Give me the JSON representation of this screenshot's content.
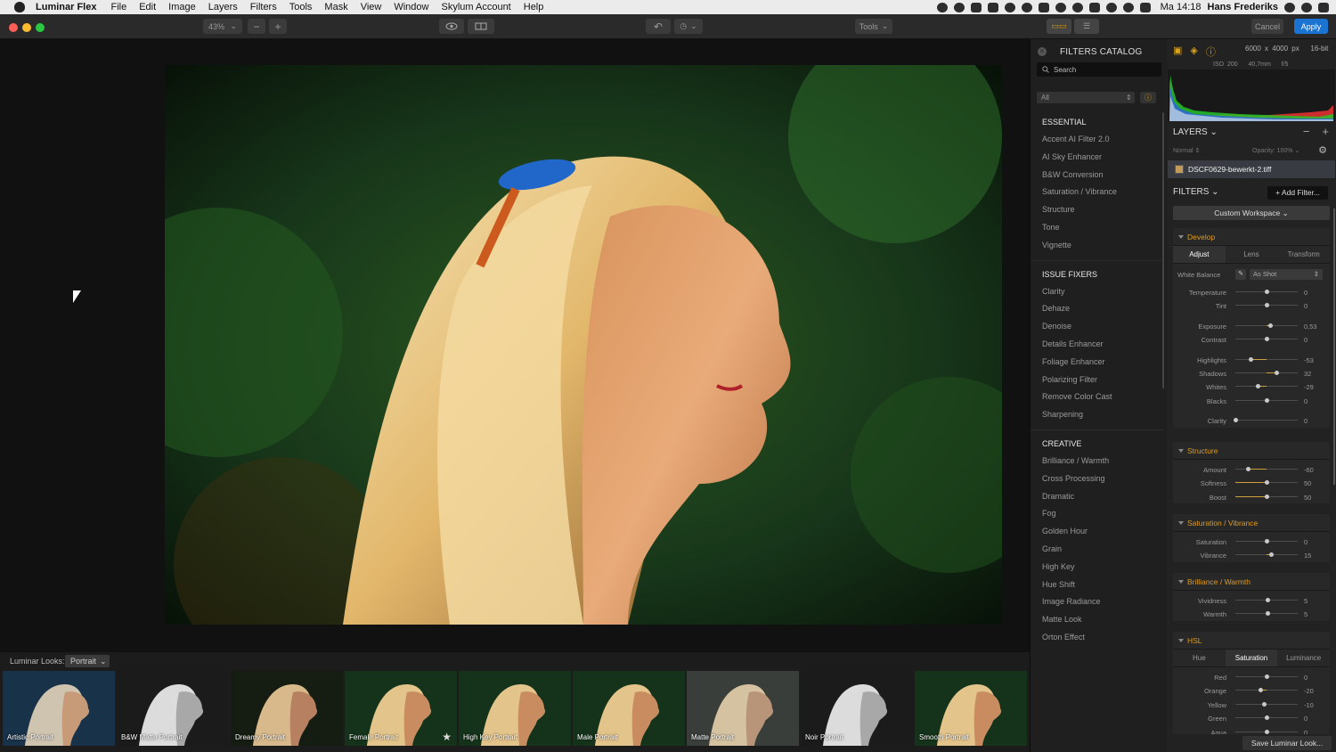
{
  "menubar": {
    "app": "Luminar Flex",
    "items": [
      "File",
      "Edit",
      "Image",
      "Layers",
      "Filters",
      "Tools",
      "Mask",
      "View",
      "Window",
      "Skylum Account",
      "Help"
    ],
    "clock": "Ma 14:18",
    "user": "Hans Frederiks"
  },
  "toolbar": {
    "zoom": "43%",
    "zoom_out": "−",
    "zoom_in": "+",
    "tools": "Tools",
    "cancel": "Cancel",
    "apply": "Apply"
  },
  "looks": {
    "label": "Luminar Looks:",
    "category": "Portrait",
    "items": [
      {
        "name": "Artistic Portrait",
        "tint": "cool"
      },
      {
        "name": "B&W Matte Portrait",
        "tint": "bw"
      },
      {
        "name": "Dreamy Portrait",
        "tint": "dark"
      },
      {
        "name": "Female Portrait",
        "tint": "green",
        "starred": true
      },
      {
        "name": "High Key Portrait",
        "tint": "green"
      },
      {
        "name": "Male Portrait",
        "tint": "green"
      },
      {
        "name": "Matte Portrait",
        "tint": "matte"
      },
      {
        "name": "Noir Portrait",
        "tint": "bw"
      },
      {
        "name": "Smooth Portrait",
        "tint": "green"
      }
    ]
  },
  "catalog": {
    "title": "FILTERS CATALOG",
    "search_placeholder": "Search",
    "filter": "All",
    "sections": [
      {
        "title": "ESSENTIAL",
        "items": [
          "Accent AI Filter 2.0",
          "AI Sky Enhancer",
          "B&W Conversion",
          "Saturation / Vibrance",
          "Structure",
          "Tone",
          "Vignette"
        ]
      },
      {
        "title": "ISSUE FIXERS",
        "items": [
          "Clarity",
          "Dehaze",
          "Denoise",
          "Details Enhancer",
          "Foliage Enhancer",
          "Polarizing Filter",
          "Remove Color Cast",
          "Sharpening"
        ]
      },
      {
        "title": "CREATIVE",
        "items": [
          "Brilliance / Warmth",
          "Cross Processing",
          "Dramatic",
          "Fog",
          "Golden Hour",
          "Grain",
          "High Key",
          "Hue Shift",
          "Image Radiance",
          "Matte Look",
          "Orton Effect"
        ]
      }
    ]
  },
  "info": {
    "dims": "6000 x 4000 px",
    "bits": "16-bit",
    "iso": "ISO 200",
    "focal": "40,7mm",
    "aperture": "f/5"
  },
  "layers": {
    "title": "LAYERS",
    "blend": "Normal",
    "opacity": "Opacity: 100%",
    "layer_name": "DSCF0629-bewerkt-2.tiff"
  },
  "filters": {
    "title": "FILTERS",
    "add": "+ Add Filter...",
    "workspace": "Custom Workspace",
    "develop": {
      "title": "Develop",
      "tabs": [
        "Adjust",
        "Lens",
        "Transform"
      ],
      "wb_label": "White Balance",
      "wb_value": "As Shot",
      "groups": [
        [
          {
            "label": "Temperature",
            "value": "0",
            "pos": 0.5,
            "centered": true
          },
          {
            "label": "Tint",
            "value": "0",
            "pos": 0.5,
            "centered": true
          }
        ],
        [
          {
            "label": "Exposure",
            "value": "0,53",
            "pos": 0.55,
            "centered": true
          },
          {
            "label": "Contrast",
            "value": "0",
            "pos": 0.5,
            "centered": true
          }
        ],
        [
          {
            "label": "Highlights",
            "value": "-53",
            "pos": 0.24,
            "centered": true
          },
          {
            "label": "Shadows",
            "value": "32",
            "pos": 0.66,
            "centered": true
          },
          {
            "label": "Whites",
            "value": "-29",
            "pos": 0.36,
            "centered": true
          },
          {
            "label": "Blacks",
            "value": "0",
            "pos": 0.5,
            "centered": true
          }
        ],
        [
          {
            "label": "Clarity",
            "value": "0",
            "pos": 0.0,
            "centered": false
          }
        ]
      ]
    },
    "structure": {
      "title": "Structure",
      "sliders": [
        {
          "label": "Amount",
          "value": "-60",
          "pos": 0.2,
          "centered": true
        },
        {
          "label": "Softness",
          "value": "50",
          "pos": 0.5,
          "centered": false
        },
        {
          "label": "Boost",
          "value": "50",
          "pos": 0.5,
          "centered": false
        }
      ]
    },
    "saturation": {
      "title": "Saturation / Vibrance",
      "sliders": [
        {
          "label": "Saturation",
          "value": "0",
          "pos": 0.5,
          "centered": true
        },
        {
          "label": "Vibrance",
          "value": "15",
          "pos": 0.57,
          "centered": true
        }
      ]
    },
    "brilliance": {
      "title": "Brilliance / Warmth",
      "sliders": [
        {
          "label": "Vividness",
          "value": "5",
          "pos": 0.52,
          "centered": true
        },
        {
          "label": "Warmth",
          "value": "5",
          "pos": 0.52,
          "centered": true
        }
      ]
    },
    "hsl": {
      "title": "HSL",
      "tabs": [
        "Hue",
        "Saturation",
        "Luminance"
      ],
      "sliders": [
        {
          "label": "Red",
          "value": "0",
          "pos": 0.5,
          "centered": true
        },
        {
          "label": "Orange",
          "value": "-20",
          "pos": 0.4,
          "centered": true
        },
        {
          "label": "Yellow",
          "value": "-10",
          "pos": 0.45,
          "centered": true
        },
        {
          "label": "Green",
          "value": "0",
          "pos": 0.5,
          "centered": true
        },
        {
          "label": "Aqua",
          "value": "0",
          "pos": 0.5,
          "centered": true
        }
      ]
    },
    "save_look": "Save Luminar Look..."
  }
}
